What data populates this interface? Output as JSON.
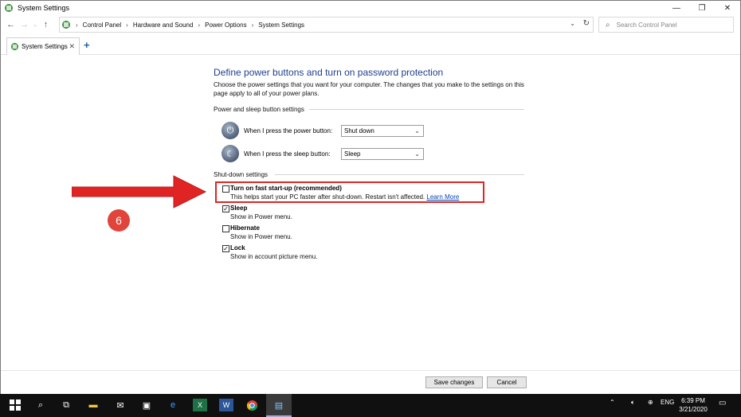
{
  "window": {
    "title": "System Settings",
    "controls": {
      "minimize": "—",
      "restore": "❐",
      "close": "✕"
    }
  },
  "address_bar": {
    "breadcrumbs": [
      "Control Panel",
      "Hardware and Sound",
      "Power Options",
      "System Settings"
    ],
    "search_placeholder": "Search Control Panel"
  },
  "tab": {
    "label": "System Settings",
    "close": "✕",
    "add": "+"
  },
  "content": {
    "heading": "Define power buttons and turn on password protection",
    "description": "Choose the power settings that you want for your computer. The changes that you make to the settings on this page apply to all of your power plans.",
    "power_section": {
      "title": "Power and sleep button settings",
      "power_button_label": "When I press the power button:",
      "power_button_value": "Shut down",
      "sleep_button_label": "When I press the sleep button:",
      "sleep_button_value": "Sleep"
    },
    "shutdown_section": {
      "title": "Shut-down settings",
      "items": [
        {
          "title": "Turn on fast start-up (recommended)",
          "description": "This helps start your PC faster after shut-down. Restart isn't affected.",
          "link": "Learn More",
          "checked": false
        },
        {
          "title": "Sleep",
          "description": "Show in Power menu.",
          "checked": true
        },
        {
          "title": "Hibernate",
          "description": "Show in Power menu.",
          "checked": false
        },
        {
          "title": "Lock",
          "description": "Show in account picture menu.",
          "checked": true
        }
      ]
    },
    "annotation_number": "6",
    "annotation_color": "#e02424"
  },
  "buttons": {
    "save": "Save changes",
    "cancel": "Cancel"
  },
  "taskbar": {
    "language": "ENG",
    "time": "6:39 PM",
    "date": "3/21/2020"
  }
}
